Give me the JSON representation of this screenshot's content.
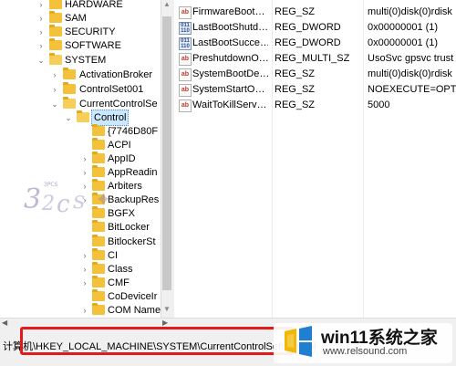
{
  "tree": {
    "items": [
      {
        "label": "HARDWARE",
        "expanded": false
      },
      {
        "label": "SAM",
        "expanded": false
      },
      {
        "label": "SECURITY",
        "expanded": false
      },
      {
        "label": "SOFTWARE",
        "expanded": false
      },
      {
        "label": "SYSTEM",
        "expanded": true
      },
      {
        "label": "ActivationBroker",
        "expanded": false
      },
      {
        "label": "ControlSet001",
        "expanded": false
      },
      {
        "label": "CurrentControlSe",
        "expanded": true
      },
      {
        "label": "Control",
        "expanded": true,
        "selected": true
      },
      {
        "label": "{7746D80F",
        "expanded": false
      },
      {
        "label": "ACPI",
        "expanded": false
      },
      {
        "label": "AppID",
        "expanded": false
      },
      {
        "label": "AppReadin",
        "expanded": false
      },
      {
        "label": "Arbiters",
        "expanded": false
      },
      {
        "label": "BackupRes",
        "expanded": false
      },
      {
        "label": "BGFX",
        "expanded": false
      },
      {
        "label": "BitLocker",
        "expanded": false
      },
      {
        "label": "BitlockerSt",
        "expanded": false
      },
      {
        "label": "CI",
        "expanded": false
      },
      {
        "label": "Class",
        "expanded": false
      },
      {
        "label": "CMF",
        "expanded": false
      },
      {
        "label": "CoDeviceIr",
        "expanded": false
      },
      {
        "label": "COM Name",
        "expanded": false
      }
    ]
  },
  "values": {
    "rows": [
      {
        "icon": "ab",
        "name": "FirmwareBoot…",
        "type": "REG_SZ",
        "data": "multi(0)disk(0)rdisk"
      },
      {
        "icon": "bin",
        "name": "LastBootShutd…",
        "type": "REG_DWORD",
        "data": "0x00000001 (1)"
      },
      {
        "icon": "bin",
        "name": "LastBootSucce…",
        "type": "REG_DWORD",
        "data": "0x00000001 (1)"
      },
      {
        "icon": "ab",
        "name": "PreshutdownO…",
        "type": "REG_MULTI_SZ",
        "data": "UsoSvc gpsvc trust"
      },
      {
        "icon": "ab",
        "name": "SystemBootDe…",
        "type": "REG_SZ",
        "data": "multi(0)disk(0)rdisk"
      },
      {
        "icon": "ab",
        "name": "SystemStartO…",
        "type": "REG_SZ",
        "data": " NOEXECUTE=OPTI"
      },
      {
        "icon": "ab",
        "name": "WaitToKillServ…",
        "type": "REG_SZ",
        "data": "5000"
      }
    ]
  },
  "status": {
    "path": "计算机\\HKEY_LOCAL_MACHINE\\SYSTEM\\CurrentControlSet\\Control"
  },
  "watermark": {
    "text": "3PCS"
  },
  "logo": {
    "title": "win11系统之家",
    "url": "www.relsound.com"
  },
  "colors": {
    "highlight": "#e11b1b",
    "folder": "#f3c23a",
    "selection": "#cce8ff"
  }
}
